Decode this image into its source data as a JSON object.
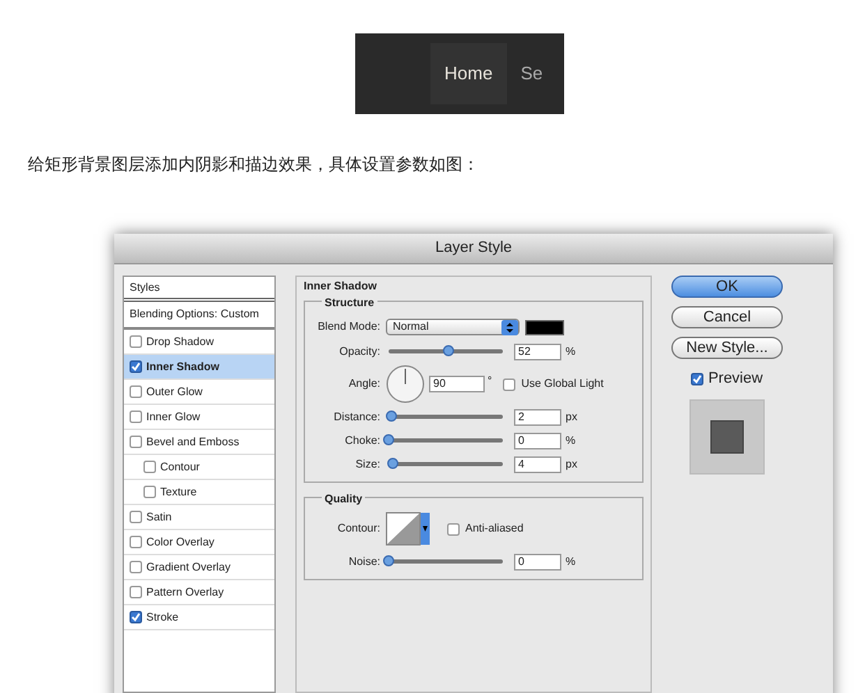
{
  "banner": {
    "nav_items": [
      {
        "label": "Home",
        "selected": true
      },
      {
        "label": "Se",
        "selected": false
      }
    ]
  },
  "paragraph": "给矩形背景图层添加内阴影和描边效果，具体设置参数如图：",
  "dialog": {
    "title": "Layer Style",
    "styles_header": "Styles",
    "blending_options": "Blending Options: Custom",
    "style_items": [
      {
        "label": "Drop Shadow",
        "checked": false,
        "selected": false
      },
      {
        "label": "Inner Shadow",
        "checked": true,
        "selected": true
      },
      {
        "label": "Outer Glow",
        "checked": false,
        "selected": false
      },
      {
        "label": "Inner Glow",
        "checked": false,
        "selected": false
      },
      {
        "label": "Bevel and Emboss",
        "checked": false,
        "selected": false,
        "children": [
          {
            "label": "Contour",
            "checked": false,
            "selected": false
          },
          {
            "label": "Texture",
            "checked": false,
            "selected": false
          }
        ]
      },
      {
        "label": "Satin",
        "checked": false,
        "selected": false
      },
      {
        "label": "Color Overlay",
        "checked": false,
        "selected": false
      },
      {
        "label": "Gradient Overlay",
        "checked": false,
        "selected": false
      },
      {
        "label": "Pattern Overlay",
        "checked": false,
        "selected": false
      },
      {
        "label": "Stroke",
        "checked": true,
        "selected": false
      }
    ],
    "section_title": "Inner Shadow",
    "structure": {
      "title": "Structure",
      "blend_mode": {
        "label": "Blend Mode:",
        "value": "Normal"
      },
      "opacity": {
        "label": "Opacity:",
        "level": 0.52,
        "value": "52",
        "unit": "%"
      },
      "angle": {
        "label": "Angle:",
        "value": "90",
        "unit": "°"
      },
      "use_global_light": {
        "label": "Use Global Light",
        "checked": false
      },
      "distance": {
        "label": "Distance:",
        "level": 0.02,
        "value": "2",
        "unit": "px"
      },
      "choke": {
        "label": "Choke:",
        "level": 0,
        "value": "0",
        "unit": "%"
      },
      "size": {
        "label": "Size:",
        "level": 0.04,
        "value": "4",
        "unit": "px"
      }
    },
    "quality": {
      "title": "Quality",
      "contour_label": "Contour:",
      "anti_aliased": {
        "label": "Anti-aliased",
        "checked": false
      },
      "noise": {
        "label": "Noise:",
        "level": 0,
        "value": "0",
        "unit": "%"
      }
    },
    "buttons": [
      {
        "label": "OK",
        "kind": "default"
      },
      {
        "label": "Cancel",
        "kind": "normal"
      },
      {
        "label": "New Style...",
        "kind": "normal"
      }
    ],
    "preview": {
      "label": "Preview",
      "checked": true
    }
  }
}
